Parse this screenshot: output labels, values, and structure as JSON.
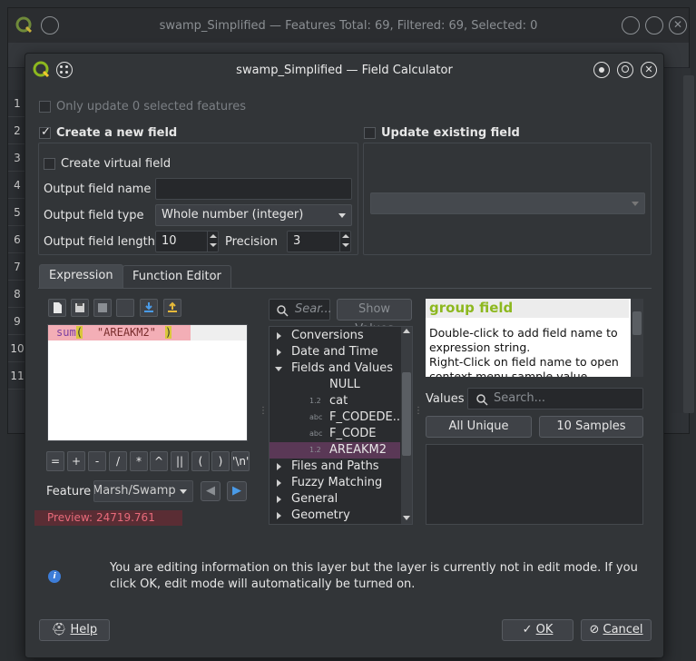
{
  "background_window": {
    "title": "swamp_Simplified — Features Total: 69, Filtered: 69, Selected: 0",
    "row_numbers": [
      "1",
      "2",
      "3",
      "4",
      "5",
      "6",
      "7",
      "8",
      "9",
      "10",
      "11"
    ]
  },
  "dialog": {
    "title": "swamp_Simplified — Field Calculator",
    "only_update_label": "Only update 0 selected features",
    "create_new_field_label": "Create a new field",
    "update_existing_label": "Update existing field",
    "create_virtual_label": "Create virtual field",
    "output_name_label": "Output field name",
    "output_name_value": "",
    "output_type_label": "Output field type",
    "output_type_value": "Whole number (integer)",
    "output_length_label": "Output field length",
    "output_length_value": "10",
    "precision_label": "Precision",
    "precision_value": "3",
    "existing_field_value": ""
  },
  "tabs": {
    "expression": "Expression",
    "function_editor": "Function Editor"
  },
  "expression": {
    "fn": "sum",
    "open": "(",
    "arg": "\"AREAKM2\"",
    "close": ")"
  },
  "operators": [
    "=",
    "+",
    "-",
    "/",
    "*",
    "^",
    "||",
    "(",
    ")",
    "'\\n'"
  ],
  "feature": {
    "label": "Feature",
    "value": "Marsh/Swamp"
  },
  "preview": {
    "label": "Preview:",
    "value": "24719.761"
  },
  "search": {
    "placeholder": "Sear...",
    "show_values": "Show Values"
  },
  "tree": [
    {
      "label": "Conversions",
      "kind": "group"
    },
    {
      "label": "Date and Time",
      "kind": "group"
    },
    {
      "label": "Fields and Values",
      "kind": "group-open"
    },
    {
      "label": "NULL",
      "kind": "leaf",
      "type": ""
    },
    {
      "label": "cat",
      "kind": "leaf",
      "type": "1.2"
    },
    {
      "label": "F_CODEDE...",
      "kind": "leaf",
      "type": "abc"
    },
    {
      "label": "F_CODE",
      "kind": "leaf",
      "type": "abc"
    },
    {
      "label": "AREAKM2",
      "kind": "leaf-selected",
      "type": "1.2"
    },
    {
      "label": "Files and Paths",
      "kind": "group"
    },
    {
      "label": "Fuzzy Matching",
      "kind": "group"
    },
    {
      "label": "General",
      "kind": "group"
    },
    {
      "label": "Geometry",
      "kind": "group"
    }
  ],
  "help_panel": {
    "title": "group field",
    "line1": "Double-click to add field name to expression string.",
    "line2": "Right-Click on field name to open context menu sample value loading"
  },
  "values": {
    "label": "Values",
    "search_placeholder": "Search...",
    "all_unique": "All Unique",
    "samples": "10 Samples"
  },
  "info_message": "You are editing information on this layer but the layer is currently not in edit mode. If you click OK, edit mode will automatically be turned on.",
  "buttons": {
    "help": "Help",
    "ok": "OK",
    "cancel": "Cancel"
  },
  "colors": {
    "accent_green": "#8db81f",
    "selection": "#5a3856",
    "preview_bg": "#5a2d34",
    "info_blue": "#3d7dd8"
  }
}
